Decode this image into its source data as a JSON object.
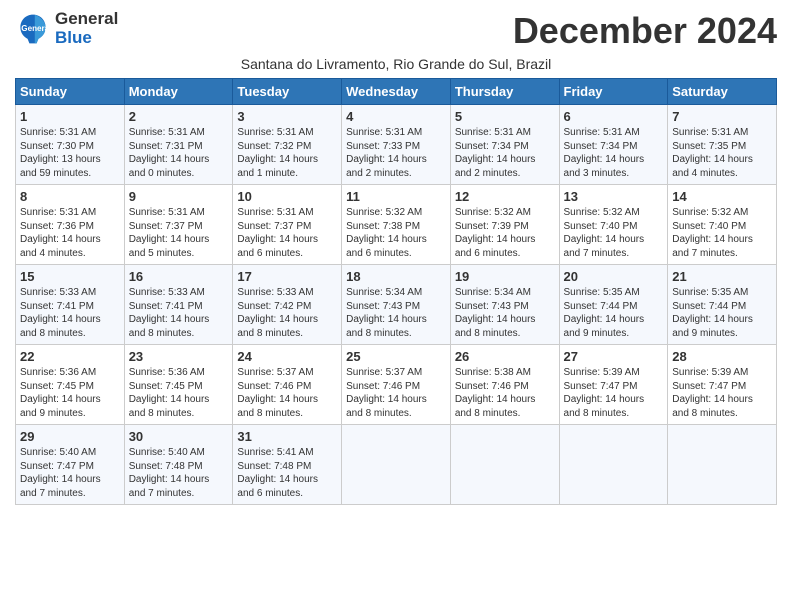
{
  "header": {
    "logo_general": "General",
    "logo_blue": "Blue",
    "month_title": "December 2024",
    "subtitle": "Santana do Livramento, Rio Grande do Sul, Brazil"
  },
  "days_of_week": [
    "Sunday",
    "Monday",
    "Tuesday",
    "Wednesday",
    "Thursday",
    "Friday",
    "Saturday"
  ],
  "weeks": [
    [
      {
        "day": 1,
        "sunrise": "5:31 AM",
        "sunset": "7:30 PM",
        "daylight": "13 hours and 59 minutes."
      },
      {
        "day": 2,
        "sunrise": "5:31 AM",
        "sunset": "7:31 PM",
        "daylight": "14 hours and 0 minutes."
      },
      {
        "day": 3,
        "sunrise": "5:31 AM",
        "sunset": "7:32 PM",
        "daylight": "14 hours and 1 minute."
      },
      {
        "day": 4,
        "sunrise": "5:31 AM",
        "sunset": "7:33 PM",
        "daylight": "14 hours and 2 minutes."
      },
      {
        "day": 5,
        "sunrise": "5:31 AM",
        "sunset": "7:34 PM",
        "daylight": "14 hours and 2 minutes."
      },
      {
        "day": 6,
        "sunrise": "5:31 AM",
        "sunset": "7:34 PM",
        "daylight": "14 hours and 3 minutes."
      },
      {
        "day": 7,
        "sunrise": "5:31 AM",
        "sunset": "7:35 PM",
        "daylight": "14 hours and 4 minutes."
      }
    ],
    [
      {
        "day": 8,
        "sunrise": "5:31 AM",
        "sunset": "7:36 PM",
        "daylight": "14 hours and 4 minutes."
      },
      {
        "day": 9,
        "sunrise": "5:31 AM",
        "sunset": "7:37 PM",
        "daylight": "14 hours and 5 minutes."
      },
      {
        "day": 10,
        "sunrise": "5:31 AM",
        "sunset": "7:37 PM",
        "daylight": "14 hours and 6 minutes."
      },
      {
        "day": 11,
        "sunrise": "5:32 AM",
        "sunset": "7:38 PM",
        "daylight": "14 hours and 6 minutes."
      },
      {
        "day": 12,
        "sunrise": "5:32 AM",
        "sunset": "7:39 PM",
        "daylight": "14 hours and 6 minutes."
      },
      {
        "day": 13,
        "sunrise": "5:32 AM",
        "sunset": "7:40 PM",
        "daylight": "14 hours and 7 minutes."
      },
      {
        "day": 14,
        "sunrise": "5:32 AM",
        "sunset": "7:40 PM",
        "daylight": "14 hours and 7 minutes."
      }
    ],
    [
      {
        "day": 15,
        "sunrise": "5:33 AM",
        "sunset": "7:41 PM",
        "daylight": "14 hours and 8 minutes."
      },
      {
        "day": 16,
        "sunrise": "5:33 AM",
        "sunset": "7:41 PM",
        "daylight": "14 hours and 8 minutes."
      },
      {
        "day": 17,
        "sunrise": "5:33 AM",
        "sunset": "7:42 PM",
        "daylight": "14 hours and 8 minutes."
      },
      {
        "day": 18,
        "sunrise": "5:34 AM",
        "sunset": "7:43 PM",
        "daylight": "14 hours and 8 minutes."
      },
      {
        "day": 19,
        "sunrise": "5:34 AM",
        "sunset": "7:43 PM",
        "daylight": "14 hours and 8 minutes."
      },
      {
        "day": 20,
        "sunrise": "5:35 AM",
        "sunset": "7:44 PM",
        "daylight": "14 hours and 9 minutes."
      },
      {
        "day": 21,
        "sunrise": "5:35 AM",
        "sunset": "7:44 PM",
        "daylight": "14 hours and 9 minutes."
      }
    ],
    [
      {
        "day": 22,
        "sunrise": "5:36 AM",
        "sunset": "7:45 PM",
        "daylight": "14 hours and 9 minutes."
      },
      {
        "day": 23,
        "sunrise": "5:36 AM",
        "sunset": "7:45 PM",
        "daylight": "14 hours and 8 minutes."
      },
      {
        "day": 24,
        "sunrise": "5:37 AM",
        "sunset": "7:46 PM",
        "daylight": "14 hours and 8 minutes."
      },
      {
        "day": 25,
        "sunrise": "5:37 AM",
        "sunset": "7:46 PM",
        "daylight": "14 hours and 8 minutes."
      },
      {
        "day": 26,
        "sunrise": "5:38 AM",
        "sunset": "7:46 PM",
        "daylight": "14 hours and 8 minutes."
      },
      {
        "day": 27,
        "sunrise": "5:39 AM",
        "sunset": "7:47 PM",
        "daylight": "14 hours and 8 minutes."
      },
      {
        "day": 28,
        "sunrise": "5:39 AM",
        "sunset": "7:47 PM",
        "daylight": "14 hours and 8 minutes."
      }
    ],
    [
      {
        "day": 29,
        "sunrise": "5:40 AM",
        "sunset": "7:47 PM",
        "daylight": "14 hours and 7 minutes."
      },
      {
        "day": 30,
        "sunrise": "5:40 AM",
        "sunset": "7:48 PM",
        "daylight": "14 hours and 7 minutes."
      },
      {
        "day": 31,
        "sunrise": "5:41 AM",
        "sunset": "7:48 PM",
        "daylight": "14 hours and 6 minutes."
      },
      null,
      null,
      null,
      null
    ]
  ]
}
